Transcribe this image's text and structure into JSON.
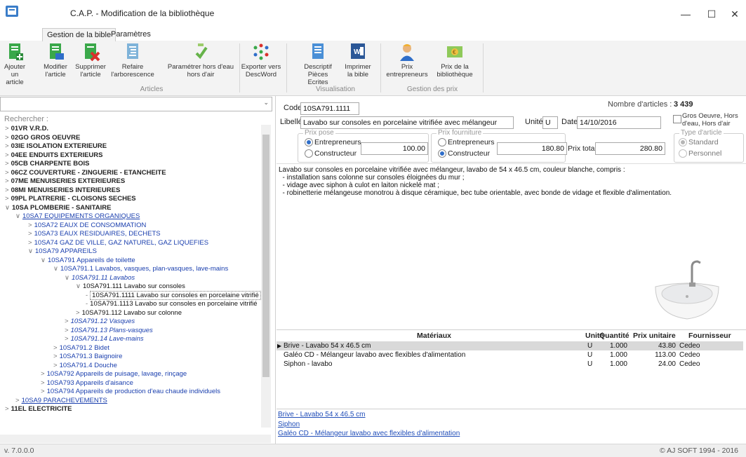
{
  "window": {
    "title": "C.A.P. - Modification de la bibliothèque",
    "minimize": "—",
    "maximize": "☐",
    "close": "✕"
  },
  "ribbon": {
    "tabs": [
      "Gestion de la bible",
      "Paramètres"
    ],
    "buttons": {
      "ajouter": [
        "Ajouter",
        "un article"
      ],
      "modifier": [
        "Modifier",
        "l'article"
      ],
      "supprimer": [
        "Supprimer",
        "l'article"
      ],
      "refaire": [
        "Refaire",
        "l'arborescence"
      ],
      "parametrer": [
        "Paramétrer hors d'eau",
        "hors d'air"
      ],
      "exporter": [
        "Exporter vers",
        "DescWord"
      ],
      "descriptif": [
        "Descriptif",
        "Pièces Ecrites"
      ],
      "imprimer": [
        "Imprimer",
        "la bible"
      ],
      "prix_entrepreneurs": [
        "Prix",
        "entrepreneurs"
      ],
      "prix_bibliotheque": [
        "Prix de la",
        "bibliothèque"
      ]
    },
    "groups": [
      "Articles",
      "Visualisation",
      "Gestion des prix"
    ]
  },
  "left": {
    "search_label": "Rechercher :",
    "tree": [
      {
        "label": "01VR V.R.D.",
        "cls": "b",
        "ex": ">"
      },
      {
        "label": "02GO GROS OEUVRE",
        "cls": "b",
        "ex": ">"
      },
      {
        "label": "03IE ISOLATION EXTERIEURE",
        "cls": "b",
        "ex": ">"
      },
      {
        "label": "04EE ENDUITS EXTERIEURS",
        "cls": "b",
        "ex": ">"
      },
      {
        "label": "05CB CHARPENTE BOIS",
        "cls": "b",
        "ex": ">"
      },
      {
        "label": "06CZ COUVERTURE - ZINGUERIE - ETANCHEITE",
        "cls": "b",
        "ex": ">"
      },
      {
        "label": "07ME MENUISERIES EXTERIEURES",
        "cls": "b",
        "ex": ">"
      },
      {
        "label": "08MI MENUISERIES INTERIEURES",
        "cls": "b",
        "ex": ">"
      },
      {
        "label": "09PL PLATRERIE - CLOISONS SECHES",
        "cls": "b",
        "ex": ">"
      },
      {
        "label": "10SA PLOMBERIE - SANITAIRE",
        "cls": "b",
        "ex": "v"
      },
      {
        "label": "10SA7 EQUIPEMENTS ORGANIQUES",
        "cls": "bl und",
        "ex": "v"
      },
      {
        "label": "10SA72 EAUX DE CONSOMMATION",
        "cls": "bl",
        "ex": ">"
      },
      {
        "label": "10SA73 EAUX RESIDUAIRES, DECHETS",
        "cls": "bl",
        "ex": ">"
      },
      {
        "label": "10SA74 GAZ DE VILLE, GAZ NATUREL, GAZ LIQUEFIES",
        "cls": "bl",
        "ex": ">"
      },
      {
        "label": "10SA79 APPAREILS",
        "cls": "bl",
        "ex": "v"
      },
      {
        "label": "10SA791 Appareils de toilette",
        "cls": "bl",
        "ex": "v"
      },
      {
        "label": "10SA791.1 Lavabos, vasques, plan-vasques, lave-mains",
        "cls": "bl",
        "ex": "v"
      },
      {
        "label": "10SA791.11 Lavabos",
        "cls": "it",
        "ex": "v"
      },
      {
        "label": "10SA791.111 Lavabo sur consoles",
        "cls": "",
        "ex": "v"
      },
      {
        "label": "10SA791.1111 Lavabo sur consoles en porcelaine vitrifié",
        "cls": "sel",
        "ex": ""
      },
      {
        "label": "10SA791.1113 Lavabo sur consoles en porcelaine vitrifié",
        "cls": "",
        "ex": ""
      },
      {
        "label": "10SA791.112 Lavabo sur colonne",
        "cls": "",
        "ex": ">"
      },
      {
        "label": "10SA791.12 Vasques",
        "cls": "it",
        "ex": ">"
      },
      {
        "label": "10SA791.13 Plans-vasques",
        "cls": "it",
        "ex": ">"
      },
      {
        "label": "10SA791.14 Lave-mains",
        "cls": "it",
        "ex": ">"
      },
      {
        "label": "10SA791.2 Bidet",
        "cls": "bl",
        "ex": ">"
      },
      {
        "label": "10SA791.3 Baignoire",
        "cls": "bl",
        "ex": ">"
      },
      {
        "label": "10SA791.4 Douche",
        "cls": "bl",
        "ex": ">"
      },
      {
        "label": "10SA792 Appareils de puisage, lavage, rinçage",
        "cls": "bl",
        "ex": ">"
      },
      {
        "label": "10SA793 Appareils d'aisance",
        "cls": "bl",
        "ex": ">"
      },
      {
        "label": "10SA794 Appareils de production d'eau chaude individuels",
        "cls": "bl",
        "ex": ">"
      },
      {
        "label": "10SA9 PARACHEVEMENTS",
        "cls": "bl und",
        "ex": ">"
      },
      {
        "label": "11EL ELECTRICITE",
        "cls": "b",
        "ex": ">"
      }
    ]
  },
  "article": {
    "code_label": "Code",
    "code": "10SA791.1111",
    "nb_label": "Nombre d'articles :",
    "nb": "3 439",
    "libelle_label": "Libellé",
    "libelle": "Lavabo sur consoles en porcelaine vitrifiée avec mélangeur",
    "unite_label": "Unité",
    "unite": "U",
    "date_label": "Date",
    "date": "14/10/2016",
    "gros_oeuvre": "Gros Oeuvre, Hors d'eau, Hors d'air",
    "prix_pose": {
      "legend": "Prix pose",
      "opt1": "Entrepreneurs",
      "opt2": "Constructeur",
      "value": "100.00"
    },
    "prix_fourniture": {
      "legend": "Prix fourniture",
      "opt1": "Entrepreneurs",
      "opt2": "Constructeur",
      "value": "180.80"
    },
    "prix_total_label": "Prix total",
    "prix_total": "280.80",
    "type": {
      "legend": "Type d'article",
      "opt1": "Standard",
      "opt2": "Personnel"
    }
  },
  "description": [
    "Lavabo sur consoles en porcelaine vitrifiée avec mélangeur, lavabo de 54 x 46.5 cm, couleur blanche, compris :",
    "  - installation sans colonne sur consoles éloignées du mur ;",
    "  - vidage avec siphon à culot en laiton nickelé mat ;",
    "  - robinetterie mélangeuse monotrou à disque céramique, bec tube orientable, avec bonde de vidage et flexible d'alimentation."
  ],
  "materials": {
    "headers": [
      "Matériaux",
      "Unité",
      "Quantité",
      "Prix unitaire",
      "Fournisseur"
    ],
    "rows": [
      [
        "Brive - Lavabo 54 x 46.5 cm",
        "U",
        "1.000",
        "43.80",
        "Cedeo"
      ],
      [
        "Galéo CD - Mélangeur lavabo avec flexibles d'alimentation",
        "U",
        "1.000",
        "113.00",
        "Cedeo"
      ],
      [
        "Siphon - lavabo",
        "U",
        "1.000",
        "24.00",
        "Cedeo"
      ]
    ]
  },
  "links": [
    "Brive - Lavabo 54 x 46.5 cm",
    "Siphon",
    "Galéo CD - Mélangeur lavabo avec flexibles d'alimentation"
  ],
  "status": {
    "version": "v. 7.0.0.0",
    "copyright": "© AJ SOFT 1994 - 2016"
  }
}
